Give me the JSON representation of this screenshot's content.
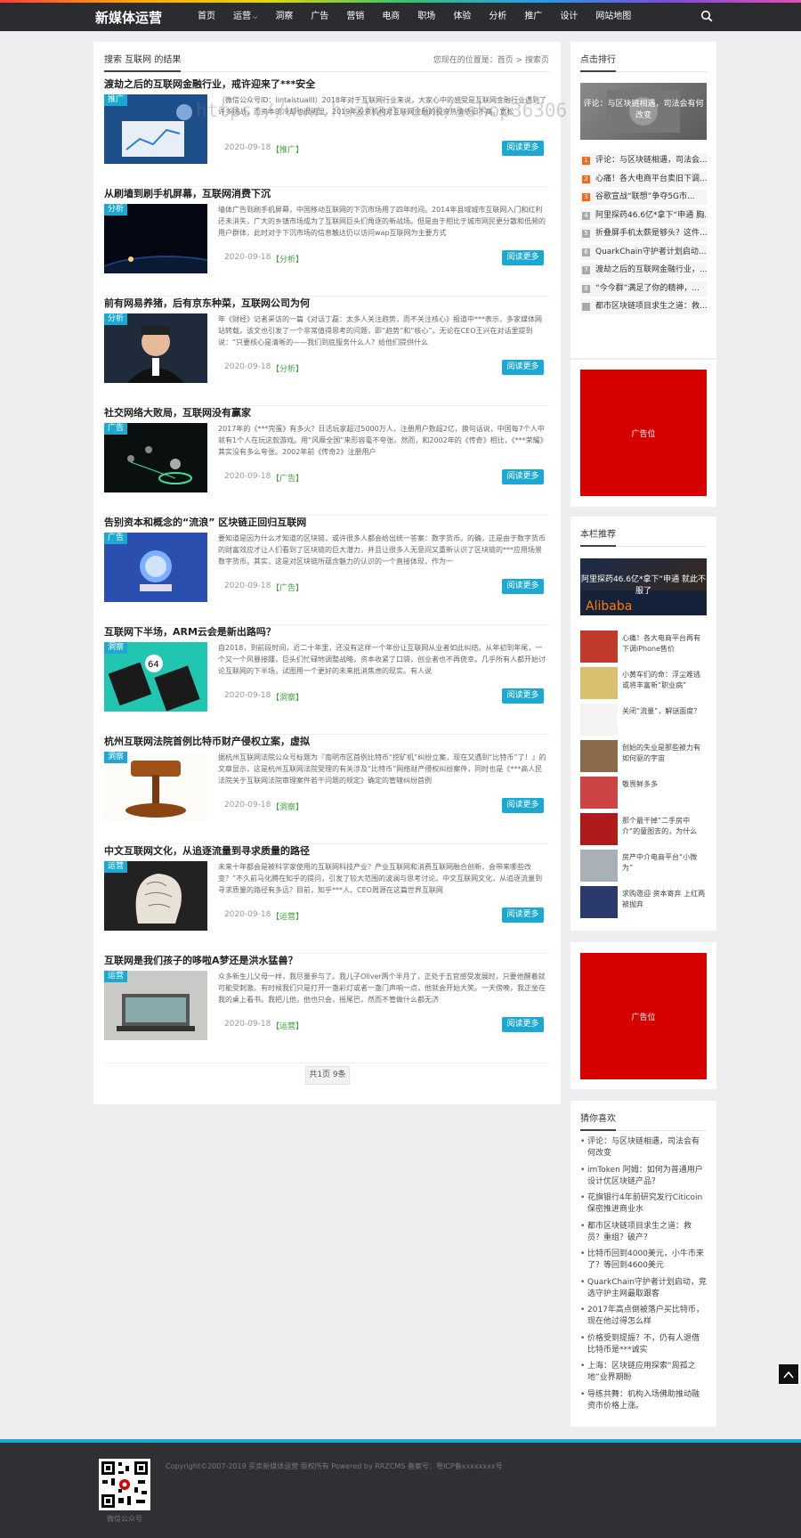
{
  "header": {
    "logo": "新媒体运营",
    "nav": [
      {
        "label": "首页",
        "dropdown": false
      },
      {
        "label": "运营",
        "dropdown": true
      },
      {
        "label": "洞察",
        "dropdown": false
      },
      {
        "label": "广告",
        "dropdown": false
      },
      {
        "label": "营销",
        "dropdown": false
      },
      {
        "label": "电商",
        "dropdown": false
      },
      {
        "label": "职场",
        "dropdown": false
      },
      {
        "label": "体验",
        "dropdown": false
      },
      {
        "label": "分析",
        "dropdown": false
      },
      {
        "label": "推广",
        "dropdown": false
      },
      {
        "label": "设计",
        "dropdown": false
      },
      {
        "label": "网站地图",
        "dropdown": false
      }
    ],
    "search_icon": "search-icon"
  },
  "main": {
    "title": "搜索 互联网 的结果",
    "location": "您现在的位置是：首页 > 搜索页",
    "articles": [
      {
        "title": "渡劫之后的互联网金融行业，戒许迎来了***安全",
        "tag": "推广",
        "excerpt": "（微信公众号ID：lintaistuaIII）2018年对于互联网行业来说，大家心中的感受是互联网金融行业遇到了许多挑战，而资本的冷却也很明显，2019年投资机构对互联网金融的投资热情依旧不高。宽松",
        "date": "2020-09-18",
        "category": "【推广】",
        "more": "阅读更多"
      },
      {
        "title": "从刷墙到刷手机屏幕，互联网消费下沉",
        "tag": "分析",
        "excerpt": "墙体广告到刷手机屏幕，中国移动互联网的下沉市场用了四年时间。2014年县域城市互联网入门和红利还未消失，广大的乡镇市场成为了互联网巨头们角逐的新战场。但是由于相比于城市网民更分散和低频的用户群体，此时对于下沉市场的信息触达仍以访问wap互联网为主要方式",
        "date": "2020-09-18",
        "category": "【分析】",
        "more": "阅读更多"
      },
      {
        "title": "前有网易养猪，后有京东种菜，互联网公司为何",
        "tag": "分析",
        "excerpt": "年《财经》记者采访的一篇《对话丁磊：太多人关注趋势，而不关注核心》报道中***表示，多家媒体网站转载，该文也引发了一个非常值得思考的问题，即“趋势”和“核心”。无论在CEO王兴在对话里提到说：“只要核心是清晰的——我们到底服务什么人？给他们提供什么",
        "date": "2020-09-18",
        "category": "【分析】",
        "more": "阅读更多"
      },
      {
        "title": "社交网络大败局，互联网没有赢家",
        "tag": "广告",
        "excerpt": "2017年的《***完蛋》有多火？日活玩家超过5000万人，注册用户数超2亿，换句话说，中国每7个人中就有1个人在玩这款游戏。用“风靡全国”来形容毫不夸张。然而，和2002年的《传奇》相比，《***荣耀》其实没有多么夸张。2002年前《传奇2》注册用户",
        "date": "2020-09-18",
        "category": "【广告】",
        "more": "阅读更多"
      },
      {
        "title": "告别资本和概念的“流浪” 区块链正回归互联网",
        "tag": "广告",
        "excerpt": "要知道是因为什么才知道的区块链，或许很多人都会给出统一答案：数字货币。的确，正是由于数字货币的财富效应才让人们看到了区块链的巨大潜力，并且让很多人无意间又重新认识了区块链的***应用场景数字货币。其实，这是对区块链所蕴含魅力的认识的一个直接体现，作为一",
        "date": "2020-09-18",
        "category": "【广告】",
        "more": "阅读更多"
      },
      {
        "title": "互联网下半场，ARM云会是新出路吗？",
        "tag": "洞察",
        "excerpt": "自2018，到前段时间，近二十年里，还没有这样一个年份让互联网从业者如此纠结。从年初到年尾，一个又一个风暴接踵，巨头们忙碌地调整战略，资本收紧了口袋，创业者也不再侥幸。几乎所有人都开始讨论互联网的下半场，试图用一个更好的未来抵消焦虑的现实。有人说",
        "date": "2020-09-18",
        "category": "【洞察】",
        "more": "阅读更多"
      },
      {
        "title": "杭州互联网法院首例比特币财产侵权立案，虚拟",
        "tag": "洞察",
        "excerpt": "据杭州互联网法院公众号标题为『南明市区首例比特币“挖矿机”纠纷立案，现在又遇到“比特币”了！』的文章显示，这是杭州互联网法院受理的有关涉及“比特币”网络财产侵权纠纷案件，同时也是《***高人民法院关于互联网法院审理案件若干问题的规定》确定的管辖纠纷首例",
        "date": "2020-09-18",
        "category": "【洞察】",
        "more": "阅读更多"
      },
      {
        "title": "中文互联网文化，从追逐流量到寻求质量的路径",
        "tag": "运营",
        "excerpt": "未来十年都会是被科学家使用的互联网科技产业？产业互联网和消费互联网融合创新，会带来哪些改变？”不久前马化腾在知乎的提问，引发了较大范围的波澜与思考讨论。中文互联网文化，从追逐流量到寻求质量的路径有多远？目前，知乎***人、CEO周源在这篇世界互联网",
        "date": "2020-09-18",
        "category": "【运营】",
        "more": "阅读更多"
      },
      {
        "title": "互联网是我们孩子的哆啦A梦还是洪水猛兽？",
        "tag": "运营",
        "excerpt": "众多新生儿父母一样，我尽量参与了。我儿子Oliver两个半月了，正处于五官感受发展时，只要他醒着就可能受刺激。有时候我们只是打开一盏彩灯或者一盏门声响一点，他就会开始大笑。一天傍晚，我正坐在我的桌上看书。我把儿他，他也只会，摇尾巴，然而不管做什么都无济",
        "date": "2020-09-18",
        "category": "【运营】",
        "more": "阅读更多"
      }
    ],
    "pagination": "共1页 9条"
  },
  "sidebar": {
    "ranking": {
      "title": "点击排行",
      "hero_caption": "评论：与区块链相遇，司法会有何改变",
      "items": [
        {
          "num": "1",
          "text": "评论：与区块链相遇，司法会..."
        },
        {
          "num": "2",
          "text": "心痛！各大电商平台卖旧下调..."
        },
        {
          "num": "3",
          "text": "谷歌宣战“联想”争夺5G市..."
        },
        {
          "num": "4",
          "text": "阿里探药46.6亿*拿下“申通 胸..."
        },
        {
          "num": "5",
          "text": "折叠屏手机太薪是够头？这件..."
        },
        {
          "num": "6",
          "text": "QuarkChain守护者计划启动..."
        },
        {
          "num": "7",
          "text": "渡劫之后的互联网金融行业，..."
        },
        {
          "num": "8",
          "text": "“今今群”满足了你的精神，..."
        },
        {
          "num": "",
          "text": "都市区块链项目求生之道：救..."
        }
      ]
    },
    "ad_label": "广告位",
    "recommend": {
      "title": "本栏推荐",
      "hero_caption": "阿里探药46.6亿*拿下“申通 就此不服了",
      "items": [
        {
          "text": "心痛！各大电商平台再有下调iPhone售价"
        },
        {
          "text": "小黄车们的命：浮尘难逃或将丰富新“职业病”"
        },
        {
          "text": "关闭“流量”，解谜面度？"
        },
        {
          "text": "创始的失业是那些被力有如何驱的宇宙"
        },
        {
          "text": "敬畏鲜多多"
        },
        {
          "text": "那个最干掉“二手房中介”的童图去的，为什么"
        },
        {
          "text": "房产中介电商平台“小微为”"
        },
        {
          "text": "求购邀迎 资本寄弃 上红两被抛弃"
        }
      ]
    },
    "guess": {
      "title": "猜你喜欢",
      "items": [
        {
          "text": "评论：与区块链相遇，司法会有何改变"
        },
        {
          "text": "imToken 阿姆：如何为普通用户设计优区块链产品？"
        },
        {
          "text": "花旗银行4年前研究发行Citicoin 保密推进商业水"
        },
        {
          "text": "都市区块链项目求生之道：救员？重组？破产？"
        },
        {
          "text": "比特币回到4000美元，小牛市来了？等回到4600美元"
        },
        {
          "text": "QuarkChain守护者计划启动，竞选守护主网最取跟客"
        },
        {
          "text": "2017年高点倒被落户买比特币，现在他过得怎么样"
        },
        {
          "text": "价格受到提振？不，仍有人退借比特币是***诚实"
        },
        {
          "text": "上海：区块链应用探索“周孤之地”业界期盼"
        },
        {
          "text": "导练共舞：机构入场佛助推动融资市价格上涨。"
        }
      ]
    }
  },
  "footer": {
    "copyright": "Copyright©2007-2019 买卖新媒体运营 版权所有 Powered by RRZCMS 备案号：粤ICP备xxxxxxxx号",
    "qr_caption": "微信公众号"
  },
  "watermark": "https://www.huzhan.com/ishop36306",
  "colors": {
    "accent": "#1ba8d3",
    "header": "#2b2c2f",
    "ad": "#d60000",
    "category": "#3aa23a",
    "rank_top": "#f06a1c",
    "rank_other": "#aaaaaa"
  }
}
